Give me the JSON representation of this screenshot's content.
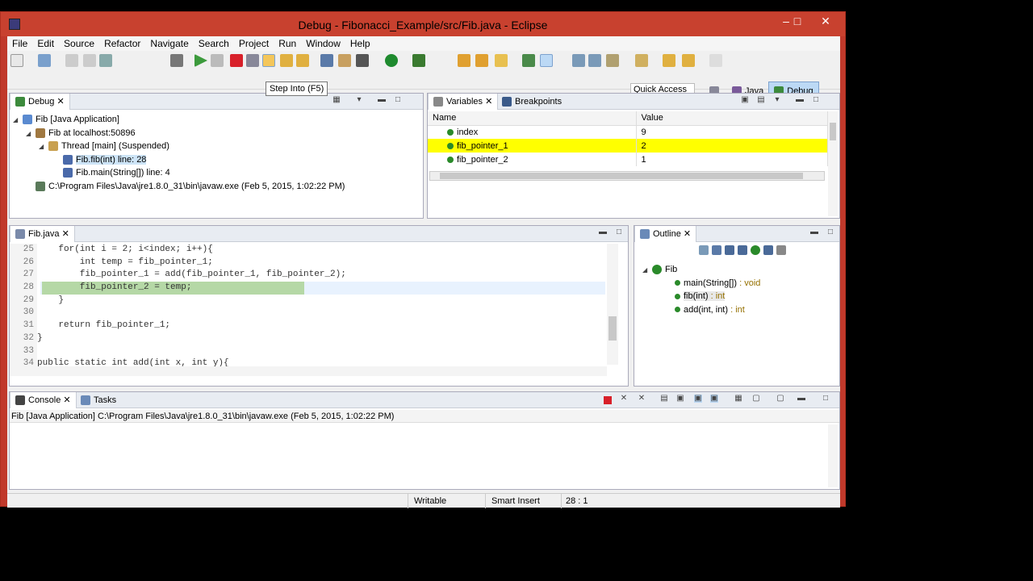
{
  "window": {
    "title": "Debug - Fibonacci_Example/src/Fib.java - Eclipse",
    "minimize": "–",
    "maximize": "□",
    "close": "✕"
  },
  "menu": [
    "File",
    "Edit",
    "Source",
    "Refactor",
    "Navigate",
    "Search",
    "Project",
    "Run",
    "Window",
    "Help"
  ],
  "toolbar": {
    "tooltip": "Step Into (F5)",
    "quick_access": "Quick Access",
    "perspectives": [
      "Java",
      "Debug"
    ]
  },
  "debug_view": {
    "tab": "Debug",
    "tree": [
      {
        "label": "Fib [Java Application]",
        "indent": 0
      },
      {
        "label": "Fib at localhost:50896",
        "indent": 1
      },
      {
        "label": "Thread [main] (Suspended)",
        "indent": 2
      },
      {
        "label": "Fib.fib(int) line: 28",
        "indent": 3
      },
      {
        "label": "Fib.main(String[]) line: 4",
        "indent": 3
      },
      {
        "label": "C:\\Program Files\\Java\\jre1.8.0_31\\bin\\javaw.exe (Feb 5, 2015, 1:02:22 PM)",
        "indent": 1
      }
    ]
  },
  "variables_view": {
    "tabs": [
      "Variables",
      "Breakpoints"
    ],
    "columns": [
      "Name",
      "Value"
    ],
    "rows": [
      {
        "name": "index",
        "value": "9"
      },
      {
        "name": "fib_pointer_1",
        "value": "2"
      },
      {
        "name": "fib_pointer_2",
        "value": "1"
      }
    ],
    "highlighted_row": 1
  },
  "editor": {
    "tab": "Fib.java",
    "lines": [
      {
        "n": "25",
        "text": "    for(int i = 2; i<index; i++){"
      },
      {
        "n": "26",
        "text": "        int temp = fib_pointer_1;"
      },
      {
        "n": "27",
        "text": "        fib_pointer_1 = add(fib_pointer_1, fib_pointer_2);"
      },
      {
        "n": "28",
        "text": "        fib_pointer_2 = temp;"
      },
      {
        "n": "29",
        "text": "    }"
      },
      {
        "n": "30",
        "text": ""
      },
      {
        "n": "31",
        "text": "    return fib_pointer_1;"
      },
      {
        "n": "32",
        "text": "}"
      },
      {
        "n": "33",
        "text": ""
      },
      {
        "n": "34",
        "text": "public static int add(int x, int y){"
      }
    ],
    "current_line": 3
  },
  "outline_view": {
    "tab": "Outline",
    "class_name": "Fib",
    "members": [
      {
        "name": "main(String[])",
        "type": " : void"
      },
      {
        "name": "fib(int)",
        "type": " : int"
      },
      {
        "name": "add(int, int)",
        "type": " : int"
      }
    ]
  },
  "console_view": {
    "tabs": [
      "Console",
      "Tasks"
    ],
    "header": "Fib [Java Application] C:\\Program Files\\Java\\jre1.8.0_31\\bin\\javaw.exe (Feb 5, 2015, 1:02:22 PM)"
  },
  "statusbar": {
    "writable": "Writable",
    "insert_mode": "Smart Insert",
    "position": "28 : 1"
  },
  "colors": {
    "titlebar": "#c8412f",
    "highlight_row": "#ffff00",
    "current_line": "#b5d8a6",
    "active_perspective": "#bcd9f5"
  }
}
